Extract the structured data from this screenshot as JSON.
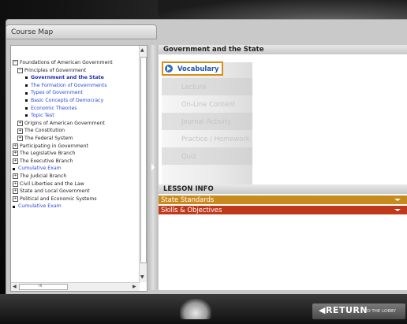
{
  "window": {
    "tab_title": "Course Map"
  },
  "tree": [
    {
      "label": "Foundations of American Government",
      "level": 0,
      "marker": "minus",
      "style": "normal"
    },
    {
      "label": "Principles of Government",
      "level": 1,
      "marker": "minus",
      "style": "normal"
    },
    {
      "label": "Government and the State",
      "level": 2,
      "marker": "square",
      "style": "bold"
    },
    {
      "label": "The Formation of Governments",
      "level": 2,
      "marker": "square",
      "style": "link"
    },
    {
      "label": "Types of Government",
      "level": 2,
      "marker": "square",
      "style": "link"
    },
    {
      "label": "Basic Concepts of Democracy",
      "level": 2,
      "marker": "square",
      "style": "link"
    },
    {
      "label": "Economic Theories",
      "level": 2,
      "marker": "square",
      "style": "link"
    },
    {
      "label": "Topic Test",
      "level": 2,
      "marker": "square",
      "style": "link"
    },
    {
      "label": "Origins of American Government",
      "level": 1,
      "marker": "plus",
      "style": "normal"
    },
    {
      "label": "The Constitution",
      "level": 1,
      "marker": "plus",
      "style": "normal"
    },
    {
      "label": "The Federal System",
      "level": 1,
      "marker": "plus",
      "style": "normal"
    },
    {
      "label": "Participating in Government",
      "level": 0,
      "marker": "plus",
      "style": "normal"
    },
    {
      "label": "The Legislative Branch",
      "level": 0,
      "marker": "plus",
      "style": "normal"
    },
    {
      "label": "The Executive Branch",
      "level": 0,
      "marker": "plus",
      "style": "normal"
    },
    {
      "label": "Cumulative Exam",
      "level": 0,
      "marker": "square",
      "style": "link"
    },
    {
      "label": "The Judicial Branch",
      "level": 0,
      "marker": "plus",
      "style": "normal"
    },
    {
      "label": "Civil Liberties and the Law",
      "level": 0,
      "marker": "plus",
      "style": "normal"
    },
    {
      "label": "State and Local Government",
      "level": 0,
      "marker": "plus",
      "style": "normal"
    },
    {
      "label": "Political and Economic Systems",
      "level": 0,
      "marker": "plus",
      "style": "normal"
    },
    {
      "label": "Cumulative Exam",
      "level": 0,
      "marker": "square",
      "style": "link"
    }
  ],
  "hscroll_label": "III",
  "lesson": {
    "title": "Government and the State",
    "items": [
      {
        "label": "Vocabulary",
        "active": true
      },
      {
        "label": "Lecture",
        "active": false
      },
      {
        "label": "On-Line Content",
        "active": false
      },
      {
        "label": "Journal Activity",
        "active": false
      },
      {
        "label": "Practice / Homework",
        "active": false
      },
      {
        "label": "Quiz",
        "active": false
      }
    ]
  },
  "lesson_info": {
    "title": "LESSON INFO",
    "bars": [
      {
        "label": "State Standards",
        "color": "#c98a1c"
      },
      {
        "label": "Skills & Objectives",
        "color": "#c0391b"
      }
    ]
  },
  "footer": {
    "return_label": "◀RETURN",
    "return_sub": "TO THE LOBBY"
  },
  "colors": {
    "accent_orange": "#d98d12",
    "link_blue": "#2a4ad8",
    "vocab_blue": "#1d54b8"
  }
}
